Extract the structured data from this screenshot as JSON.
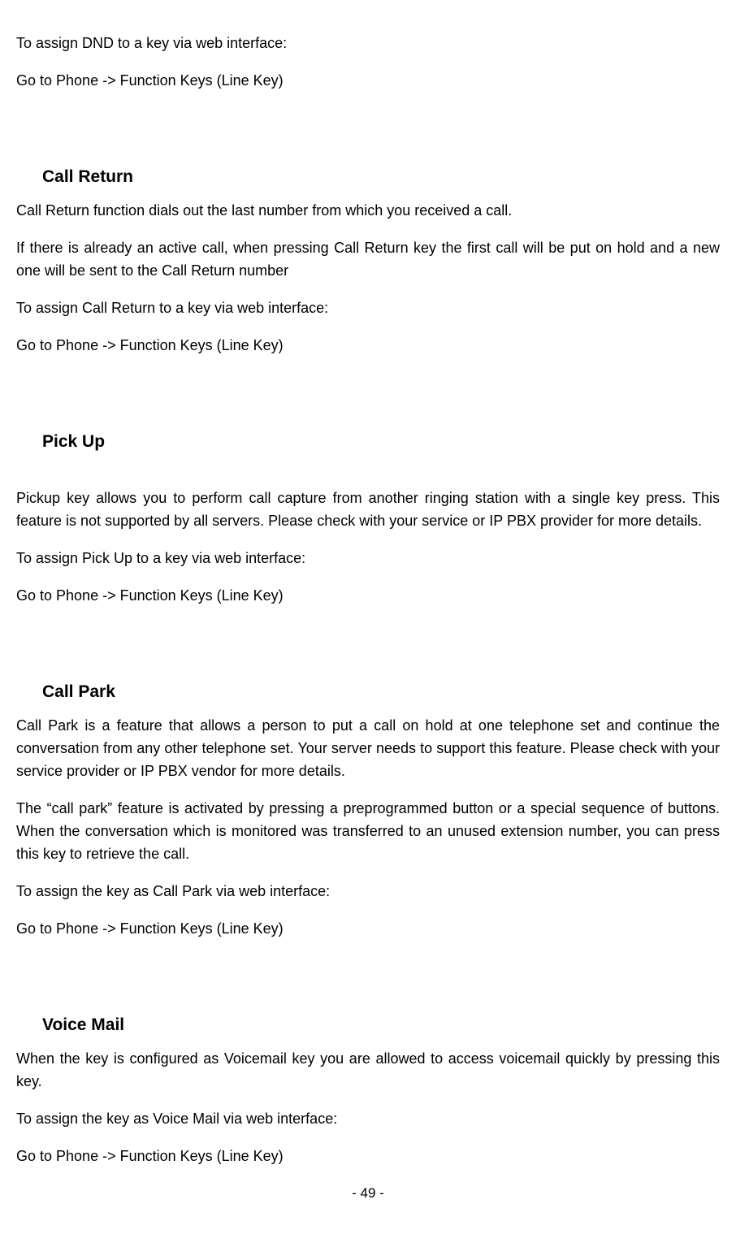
{
  "intro": {
    "p1": "To assign DND to a key via web interface:",
    "p2": "Go to Phone -> Function Keys (Line Key)"
  },
  "sections": {
    "callReturn": {
      "title": "Call Return",
      "p1": "Call Return function dials out the last number from which you received a call.",
      "p2": "If there is already an active call, when pressing Call Return key the first call will be put on hold and a new one will be sent to the Call Return number",
      "p3": "To assign Call Return to a key via web interface:",
      "p4": "Go to Phone -> Function Keys (Line Key)"
    },
    "pickUp": {
      "title": "Pick Up",
      "p1": "Pickup key allows you to perform call capture from another ringing station with a single key press. This feature is not supported by all servers. Please check with your service or IP PBX provider for more details.",
      "p2": "To assign Pick Up to a key via web interface:",
      "p3": "Go to Phone -> Function Keys (Line Key)"
    },
    "callPark": {
      "title": "Call Park",
      "p1": "Call Park is a feature that allows a person to put a call on hold at one telephone set and continue the conversation from any other telephone set. Your server needs to support this feature. Please check with your service provider or IP PBX vendor for more details.",
      "p2": "The “call park” feature is activated by pressing a preprogrammed button or a special sequence of buttons. When the conversation which is monitored was transferred to an unused extension number, you can press this key to retrieve the call.",
      "p3": "To assign the key as Call Park via web interface:",
      "p4": "Go to Phone -> Function Keys (Line Key)"
    },
    "voiceMail": {
      "title": "Voice Mail",
      "p1": "When the key is configured as Voicemail key you are allowed to access voicemail quickly by pressing this key.",
      "p2": "To assign the key as Voice Mail via web interface:",
      "p3": "Go to Phone -> Function Keys (Line Key)"
    }
  },
  "footer": {
    "pageNumber": "- 49 -"
  }
}
